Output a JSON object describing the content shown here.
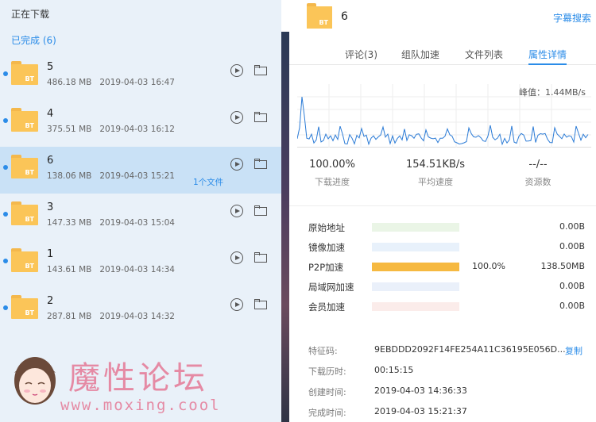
{
  "left": {
    "section_title": "正在下载",
    "completed_title": "已完成 (6)",
    "items": [
      {
        "name": "5",
        "size": "486.18 MB",
        "date": "2019-04-03 16:47",
        "files": ""
      },
      {
        "name": "4",
        "size": "375.51 MB",
        "date": "2019-04-03 16:12",
        "files": ""
      },
      {
        "name": "6",
        "size": "138.06 MB",
        "date": "2019-04-03 15:21",
        "files": "1个文件"
      },
      {
        "name": "3",
        "size": "147.33 MB",
        "date": "2019-04-03 15:04",
        "files": ""
      },
      {
        "name": "1",
        "size": "143.61 MB",
        "date": "2019-04-03 14:34",
        "files": ""
      },
      {
        "name": "2",
        "size": "287.81 MB",
        "date": "2019-04-03 14:32",
        "files": ""
      }
    ],
    "folder_badge": "BT",
    "watermark": {
      "title": "魔性论坛",
      "url": "www.moxing.cool"
    }
  },
  "right": {
    "title": "6",
    "subtitle_link": "字幕搜索",
    "folder_badge": "BT",
    "tabs": [
      "评论(3)",
      "组队加速",
      "文件列表",
      "属性详情"
    ],
    "active_tab": 3,
    "peak": "峰值：1.44MB/s",
    "stats": [
      {
        "value": "100.00%",
        "label": "下载进度"
      },
      {
        "value": "154.51KB/s",
        "label": "平均速度"
      },
      {
        "value": "--/--",
        "label": "资源数"
      }
    ],
    "sources": [
      {
        "label": "原始地址",
        "pct": "",
        "fill": 0,
        "size": "0.00B",
        "color": "#eaf5e6"
      },
      {
        "label": "镜像加速",
        "pct": "",
        "fill": 0,
        "size": "0.00B",
        "color": "#e8f1fb"
      },
      {
        "label": "P2P加速",
        "pct": "100.0%",
        "fill": 1.0,
        "size": "138.50MB",
        "color": "#f6b941"
      },
      {
        "label": "局域网加速",
        "pct": "",
        "fill": 0,
        "size": "0.00B",
        "color": "#eaf0fa"
      },
      {
        "label": "会员加速",
        "pct": "",
        "fill": 0,
        "size": "0.00B",
        "color": "#fbecea"
      }
    ],
    "details": [
      {
        "key": "特征码:",
        "value": "9EBDDD2092F14FE254A11C36195E056D...",
        "action": "复制"
      },
      {
        "key": "下载历时:",
        "value": "00:15:15"
      },
      {
        "key": "创建时间:",
        "value": "2019-04-03 14:36:33"
      },
      {
        "key": "完成时间:",
        "value": "2019-04-03 15:21:37"
      }
    ]
  },
  "colors": {
    "accent": "#2b8ce8",
    "folder": "#fbc558",
    "selected_row": "#c9e1f6",
    "p2p_bar": "#f6b941"
  }
}
